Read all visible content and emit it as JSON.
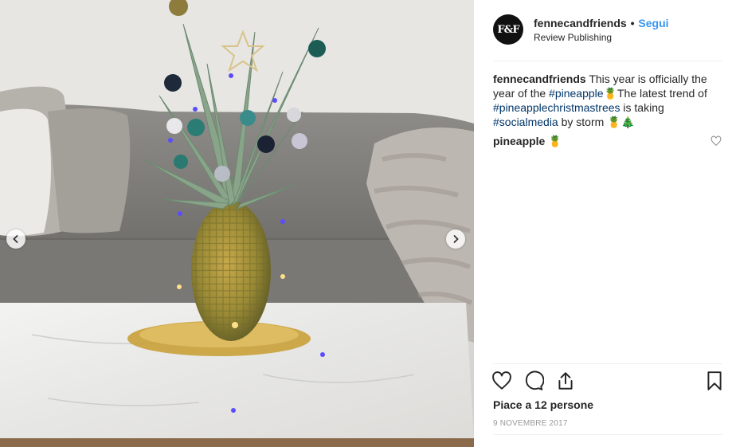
{
  "post": {
    "username": "fennecandfriends",
    "separator": "•",
    "follow_label": "Segui",
    "subtitle": "Review Publishing",
    "avatar_text": "F&F"
  },
  "caption": {
    "username": "fennecandfriends",
    "part1": " This year is officially the year of the ",
    "tag1": "#pineapple",
    "emoji1": "🍍",
    "part2": "The latest trend of ",
    "tag2": "#pineapplechristmastrees",
    "part3": " is taking ",
    "tag3": "#socialmedia",
    "part4": " by storm ",
    "emoji2": "🍍🎄"
  },
  "comment": {
    "text": "pineapple",
    "emoji": "🍍"
  },
  "likes_text": "Piace a 12 persone",
  "date": "9 NOVEMBRE 2017",
  "icons": {
    "like": "heart-icon",
    "comment": "comment-icon",
    "share": "share-icon",
    "save": "bookmark-icon",
    "prev": "chevron-left-icon",
    "next": "chevron-right-icon"
  },
  "colors": {
    "follow": "#3897f0",
    "hashtag": "#003569",
    "date": "#999999"
  }
}
